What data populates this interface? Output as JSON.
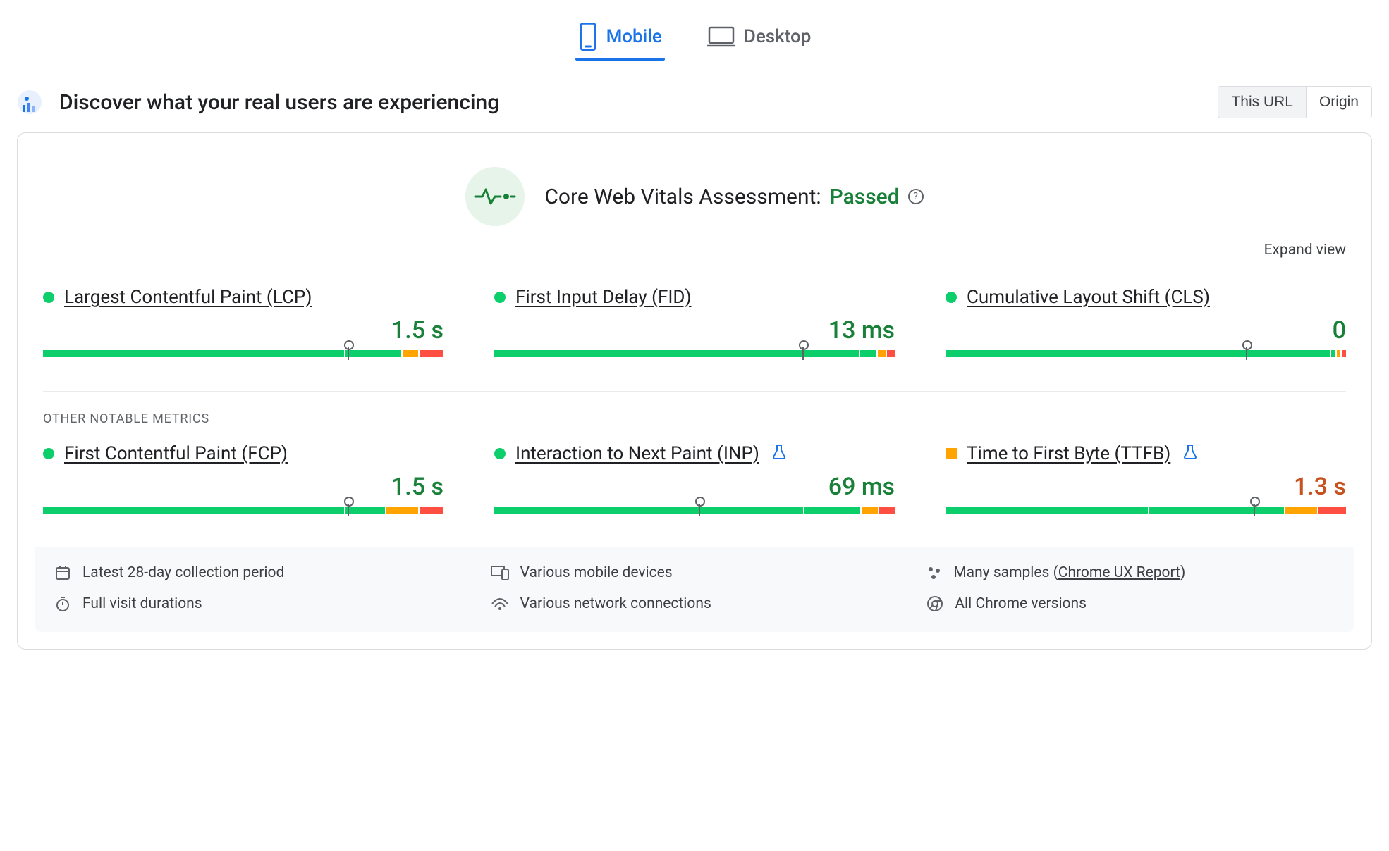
{
  "tabs": {
    "mobile": "Mobile",
    "desktop": "Desktop",
    "active": "mobile"
  },
  "header": {
    "title": "Discover what your real users are experiencing",
    "toggle": {
      "this_url": "This URL",
      "origin": "Origin"
    }
  },
  "assessment": {
    "prefix": "Core Web Vitals Assessment:",
    "status": "Passed"
  },
  "expand_view": "Expand view",
  "other_label": "OTHER NOTABLE METRICS",
  "metrics": {
    "lcp": {
      "name": "Largest Contentful Paint (LCP)",
      "value": "1.5 s",
      "status": "green",
      "dist": [
        76,
        14,
        4,
        6
      ],
      "marker": 76
    },
    "fid": {
      "name": "First Input Delay (FID)",
      "value": "13 ms",
      "status": "green",
      "dist": [
        92,
        4,
        2,
        2
      ],
      "marker": 77
    },
    "cls": {
      "name": "Cumulative Layout Shift (CLS)",
      "value": "0",
      "status": "green",
      "dist": [
        97,
        1,
        1,
        1
      ],
      "marker": 75
    },
    "fcp": {
      "name": "First Contentful Paint (FCP)",
      "value": "1.5 s",
      "status": "green",
      "dist": [
        76,
        10,
        8,
        6
      ],
      "marker": 76
    },
    "inp": {
      "name": "Interaction to Next Paint (INP)",
      "value": "69 ms",
      "status": "green",
      "dist": [
        78,
        14,
        4,
        4
      ],
      "marker": 51,
      "experimental": true
    },
    "ttfb": {
      "name": "Time to First Byte (TTFB)",
      "value": "1.3 s",
      "status": "orange",
      "dist": [
        51,
        34,
        8,
        7
      ],
      "marker": 77,
      "experimental": true
    }
  },
  "footer": {
    "period": "Latest 28-day collection period",
    "devices": "Various mobile devices",
    "samples_prefix": "Many samples (",
    "samples_link": "Chrome UX Report",
    "samples_suffix": ")",
    "duration": "Full visit durations",
    "network": "Various network connections",
    "versions": "All Chrome versions"
  },
  "colors": {
    "good": "#0cce6b",
    "needs": "#ffa400",
    "poor": "#ff4e42",
    "primary": "#1a73e8"
  }
}
